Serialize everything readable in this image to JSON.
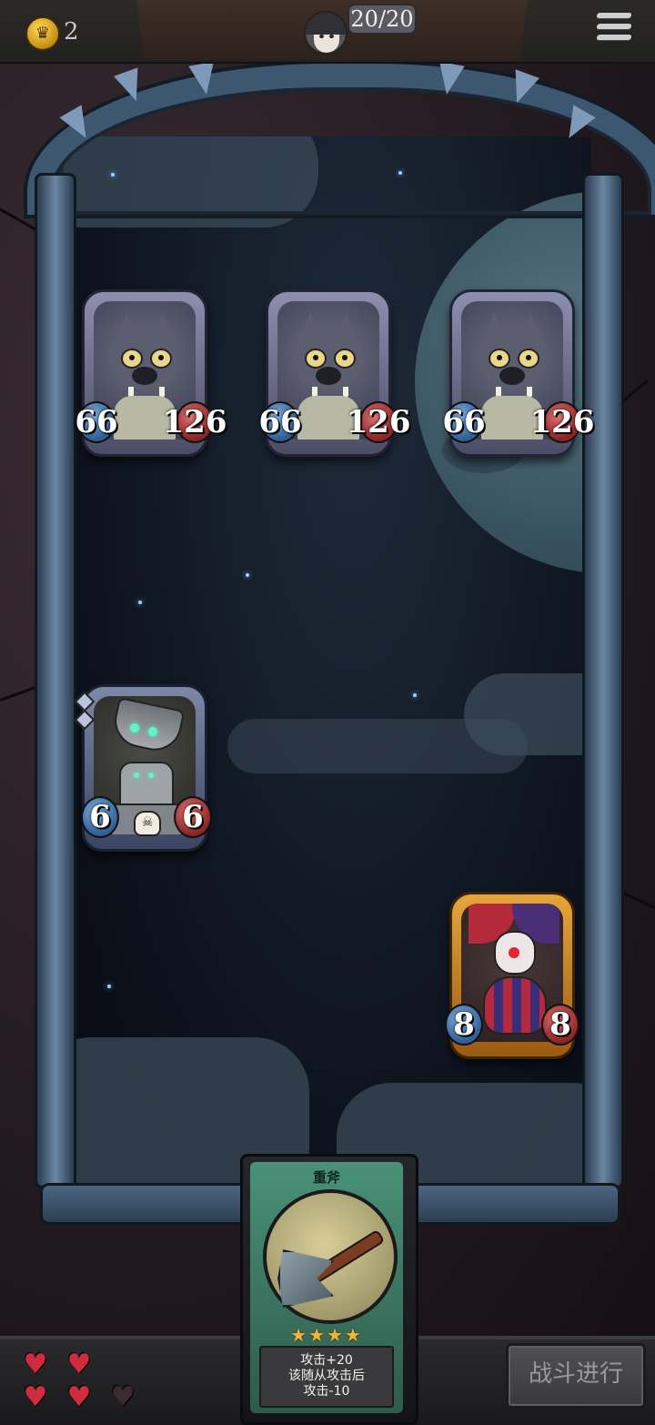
{
  "top_bar": {
    "gold_icon": "crown-coin-icon",
    "gold_count": "2",
    "hero_hp": "20/20",
    "menu_icon": "hamburger-menu-icon"
  },
  "enemies": [
    {
      "name_icon": "wolf-portrait",
      "attack": "66",
      "health": "126"
    },
    {
      "name_icon": "wolf-portrait",
      "attack": "66",
      "health": "126"
    },
    {
      "name_icon": "wolf-portrait",
      "attack": "66",
      "health": "126"
    }
  ],
  "allies": [
    {
      "name_icon": "robot-portrait",
      "attack": "6",
      "health": "6"
    },
    {
      "name_icon": "clown-portrait",
      "attack": "8",
      "health": "8"
    }
  ],
  "hand_card": {
    "title": "重斧",
    "icon": "axe-icon",
    "stars": "★★★★",
    "rarity_stars": 4,
    "description_lines": [
      "攻击+20",
      "该随从攻击后",
      "攻击-10"
    ]
  },
  "bottom_bar": {
    "lives_filled": 4,
    "lives_total": 5,
    "battle_button_label": "战斗进行"
  },
  "colors": {
    "attack_badge": "#2f5f96",
    "health_badge": "#8d2525",
    "card_green": "#4a9178",
    "heart_red": "#cf2c3f"
  }
}
